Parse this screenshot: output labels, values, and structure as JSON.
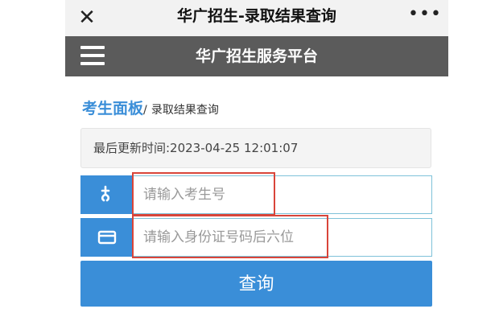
{
  "topbar": {
    "title": "华广招生-录取结果查询",
    "close_icon": "close-icon",
    "more_icon": "more-icon",
    "background": "#f2f2f2"
  },
  "sitebar": {
    "title": "华广招生服务平台",
    "menu_icon": "hamburger-menu-icon",
    "background": "#5b5b5b"
  },
  "breadcrumb": {
    "main": "考生面板",
    "separator": "/",
    "sub": "录取结果查询"
  },
  "update": {
    "text": "最后更新时间:2023-04-25 12:01:07"
  },
  "form": {
    "exam_no": {
      "placeholder": "请输入考生号",
      "value": "",
      "icon": "user-icon"
    },
    "id_last6": {
      "placeholder": "请输入身份证号码后六位",
      "value": "",
      "icon": "id-card-icon"
    },
    "submit_label": "查询"
  },
  "colors": {
    "accent": "#3a8ed8",
    "input_border": "#7fc2d9",
    "highlight": "#d9453a"
  }
}
